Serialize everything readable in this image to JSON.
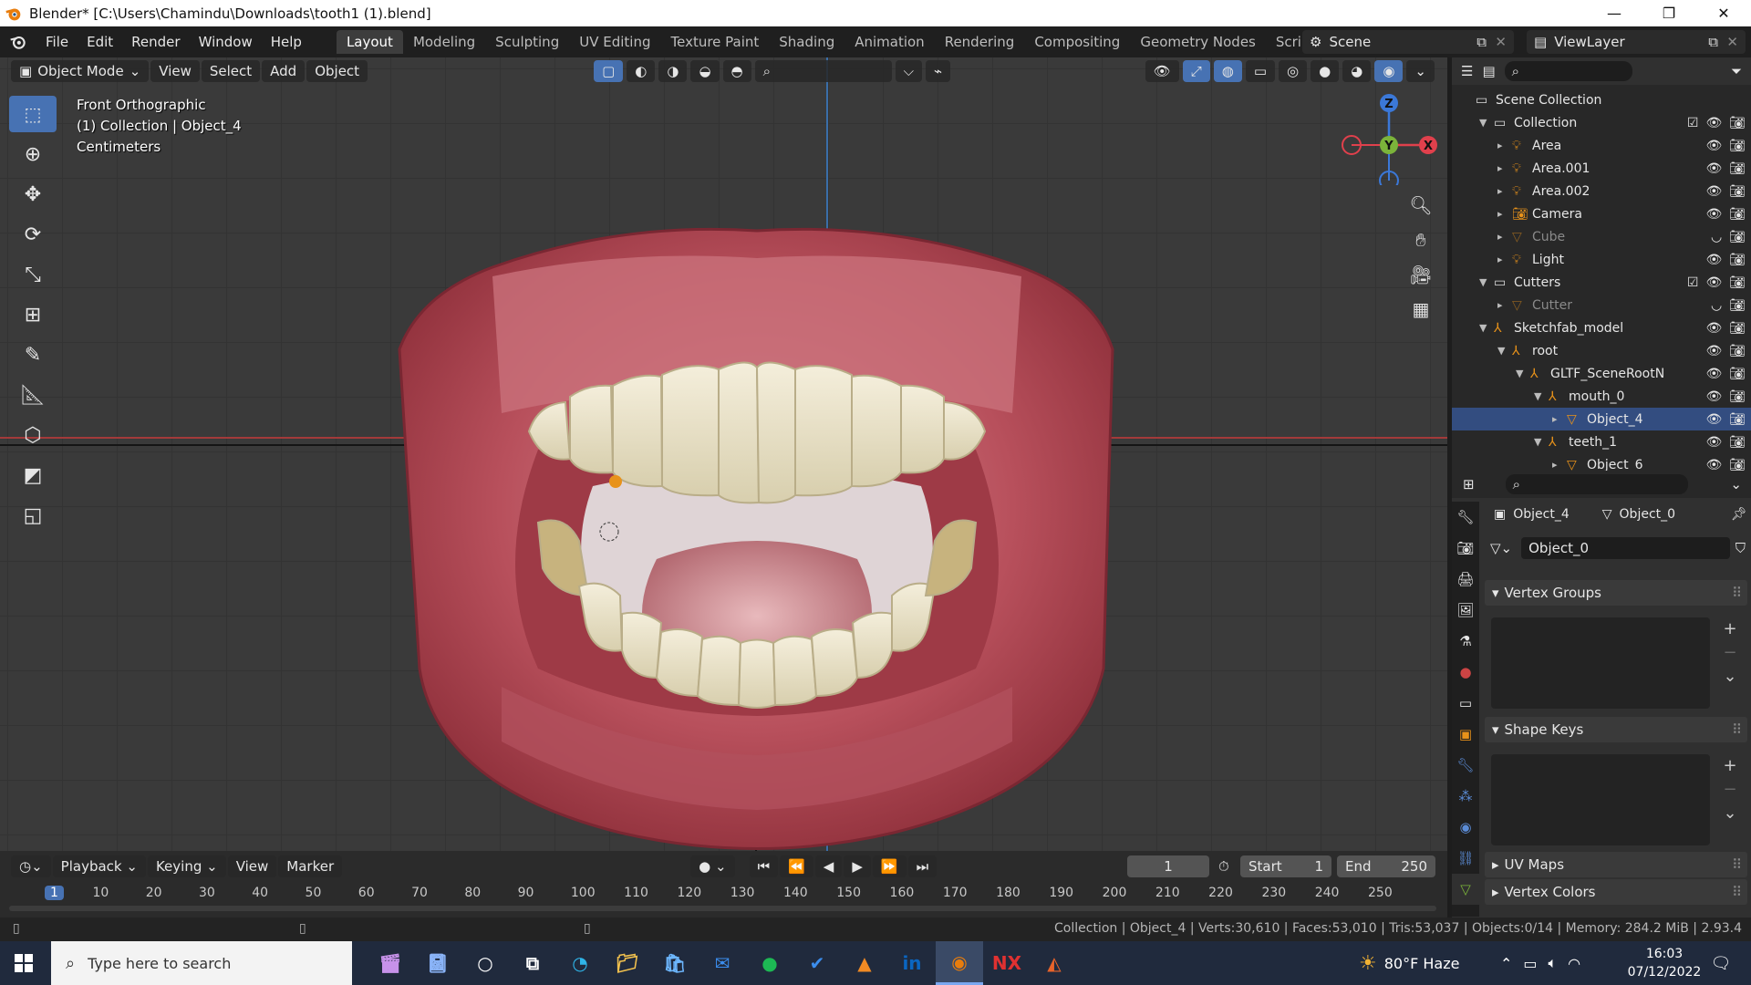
{
  "window": {
    "title": "Blender* [C:\\Users\\Chamindu\\Downloads\\tooth1 (1).blend]",
    "minimize_icon": "minimize-icon",
    "maximize_icon": "restore-icon",
    "close_icon": "close-icon"
  },
  "menu": [
    "File",
    "Edit",
    "Render",
    "Window",
    "Help"
  ],
  "workspaces": [
    "Layout",
    "Modeling",
    "Sculpting",
    "UV Editing",
    "Texture Paint",
    "Shading",
    "Animation",
    "Rendering",
    "Compositing",
    "Geometry Nodes",
    "Scripting"
  ],
  "active_workspace": "Layout",
  "add_workspace": "+",
  "scene": {
    "label": "Scene"
  },
  "view_layer": {
    "label": "ViewLayer"
  },
  "viewport": {
    "mode": "Object Mode",
    "header_menus": [
      "View",
      "Select",
      "Add",
      "Object"
    ],
    "overlay": {
      "view_name": "Front Orthographic",
      "collection_info": "(1) Collection | Object_4",
      "units": "Centimeters"
    },
    "gizmo": {
      "z": "Z",
      "y": "Y",
      "x": "X"
    }
  },
  "outliner": {
    "rows": [
      {
        "name": "Scene Collection",
        "icon": "scene-collection-icon",
        "depth": 0,
        "dim": false,
        "expand": ""
      },
      {
        "name": "Collection",
        "icon": "collection-icon",
        "depth": 1,
        "dim": false,
        "expand": "▼",
        "checkbox": true
      },
      {
        "name": "Area",
        "icon": "light-icon",
        "depth": 2,
        "dim": false,
        "expand": "▸"
      },
      {
        "name": "Area.001",
        "icon": "light-icon",
        "depth": 2,
        "dim": false,
        "expand": "▸"
      },
      {
        "name": "Area.002",
        "icon": "light-icon",
        "depth": 2,
        "dim": false,
        "expand": "▸"
      },
      {
        "name": "Camera",
        "icon": "camera-icon",
        "depth": 2,
        "dim": false,
        "expand": "▸"
      },
      {
        "name": "Cube",
        "icon": "mesh-icon",
        "depth": 2,
        "dim": true,
        "expand": "▸"
      },
      {
        "name": "Light",
        "icon": "light-icon",
        "depth": 2,
        "dim": false,
        "expand": "▸"
      },
      {
        "name": "Cutters",
        "icon": "collection-icon",
        "depth": 1,
        "dim": false,
        "expand": "▼",
        "checkbox": true
      },
      {
        "name": "Cutter",
        "icon": "mesh-icon",
        "depth": 2,
        "dim": true,
        "expand": "▸"
      },
      {
        "name": "Sketchfab_model",
        "icon": "empty-icon",
        "depth": 1,
        "dim": false,
        "expand": "▼"
      },
      {
        "name": "root",
        "icon": "empty-icon",
        "depth": 2,
        "dim": false,
        "expand": "▼"
      },
      {
        "name": "GLTF_SceneRootN",
        "icon": "empty-icon",
        "depth": 3,
        "dim": false,
        "expand": "▼"
      },
      {
        "name": "mouth_0",
        "icon": "empty-icon",
        "depth": 4,
        "dim": false,
        "expand": "▼"
      },
      {
        "name": "Object_4",
        "icon": "mesh-icon",
        "depth": 5,
        "dim": false,
        "expand": "▸",
        "selected": true
      },
      {
        "name": "teeth_1",
        "icon": "empty-icon",
        "depth": 4,
        "dim": false,
        "expand": "▼"
      },
      {
        "name": "Object_6",
        "icon": "mesh-icon",
        "depth": 5,
        "dim": false,
        "expand": "▸"
      }
    ]
  },
  "properties": {
    "object_name": "Object_4",
    "mesh_name": "Object_0",
    "data_field": "Object_0",
    "panels": {
      "vertex_groups": "Vertex Groups",
      "shape_keys": "Shape Keys",
      "uv_maps": "UV Maps",
      "vertex_colors": "Vertex Colors"
    }
  },
  "timeline": {
    "menus": [
      "Playback",
      "Keying",
      "View",
      "Marker"
    ],
    "current_frame": "1",
    "start_label": "Start",
    "start": "1",
    "end_label": "End",
    "end": "250",
    "ruler": [
      "1",
      "10",
      "20",
      "30",
      "40",
      "50",
      "60",
      "70",
      "80",
      "90",
      "100",
      "110",
      "120",
      "130",
      "140",
      "150",
      "160",
      "170",
      "180",
      "190",
      "200",
      "210",
      "220",
      "230",
      "240",
      "250"
    ]
  },
  "status": {
    "text": "Collection | Object_4 | Verts:30,610 | Faces:53,010 | Tris:53,037 | Objects:0/14 | Memory: 284.2 MiB | 2.93.4"
  },
  "taskbar": {
    "search_placeholder": "Type here to search",
    "weather": "80°F  Haze",
    "time": "16:03",
    "date": "07/12/2022",
    "apps": [
      "clapper-icon",
      "notepad-icon",
      "cortana-icon",
      "task-view-icon",
      "edge-icon",
      "file-explorer-icon",
      "store-icon",
      "mail-icon",
      "spotify-icon",
      "todo-icon",
      "vlc-icon",
      "linkedin-icon",
      "blender-icon",
      "nx-icon",
      "matlab-icon"
    ]
  },
  "colors": {
    "accent": "#4772b3",
    "active_tab": "#3d3d3d",
    "selection": "#334d80",
    "gizmo_x": "#e0404c",
    "gizmo_y": "#7bb33a",
    "gizmo_z": "#3b78d8"
  }
}
